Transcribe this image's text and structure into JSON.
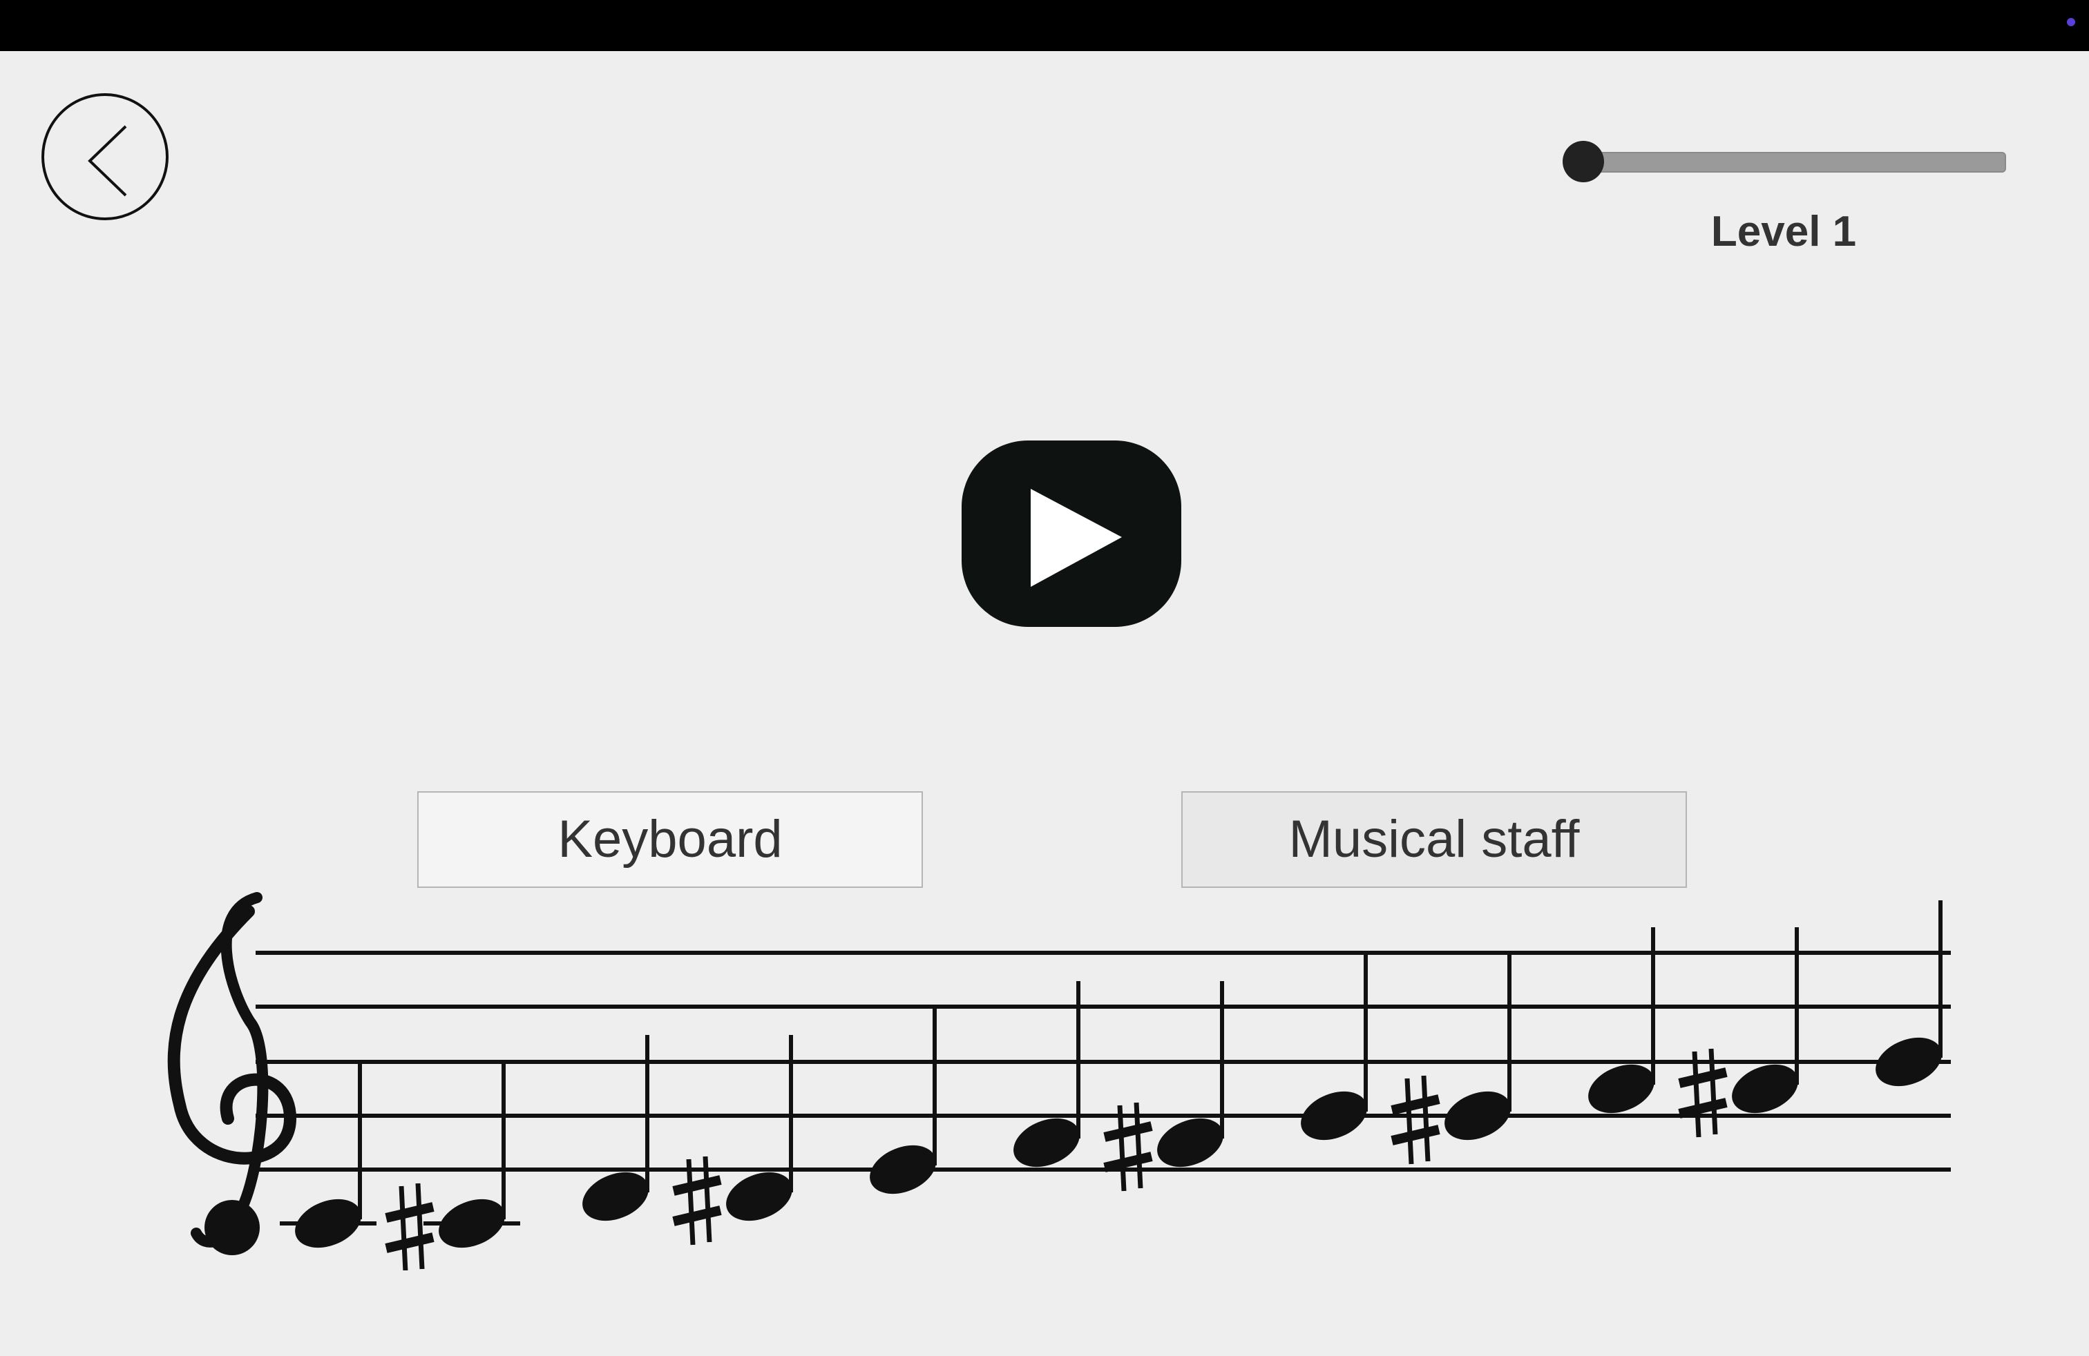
{
  "colors": {
    "background": "#eeeeee",
    "topbar": "#000000",
    "status_dot": "#5a3fd8",
    "ink": "#111111"
  },
  "header": {
    "back_icon": "chevron-left-icon"
  },
  "level_slider": {
    "level_label": "Level 1",
    "position_fraction": 0.0
  },
  "player": {
    "icon": "play-icon"
  },
  "modes": {
    "keyboard_label": "Keyboard",
    "staff_label": "Musical staff",
    "selected": "Musical staff"
  },
  "staff": {
    "clef": "treble-clef",
    "notes": [
      {
        "pitch": "C4",
        "sharp": false
      },
      {
        "pitch": "C4",
        "sharp": true
      },
      {
        "pitch": "D4",
        "sharp": false
      },
      {
        "pitch": "D4",
        "sharp": true
      },
      {
        "pitch": "E4",
        "sharp": false
      },
      {
        "pitch": "F4",
        "sharp": false
      },
      {
        "pitch": "F4",
        "sharp": true
      },
      {
        "pitch": "G4",
        "sharp": false
      },
      {
        "pitch": "G4",
        "sharp": true
      },
      {
        "pitch": "A4",
        "sharp": false
      },
      {
        "pitch": "A4",
        "sharp": true
      },
      {
        "pitch": "B4",
        "sharp": false
      }
    ]
  }
}
